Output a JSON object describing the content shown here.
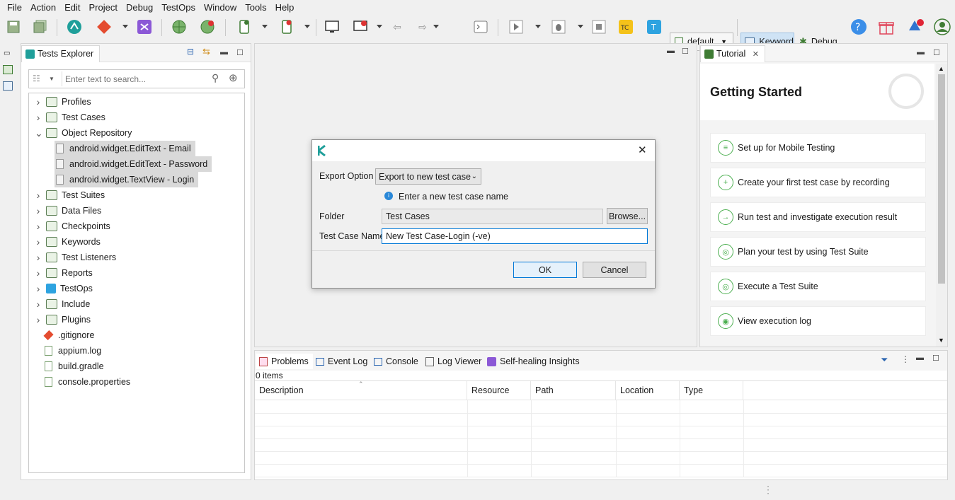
{
  "menu": [
    "File",
    "Action",
    "Edit",
    "Project",
    "Debug",
    "TestOps",
    "Window",
    "Tools",
    "Help"
  ],
  "toolbar": {
    "profile_select": "default",
    "keyword_label": "Keyword",
    "debug_label": "Debug"
  },
  "explorer": {
    "tab_title": "Tests Explorer",
    "search_placeholder": "Enter text to search...",
    "tree": [
      {
        "label": "Profiles",
        "expand": "right",
        "icon": "profiles-icon"
      },
      {
        "label": "Test Cases",
        "expand": "right",
        "icon": "test-cases-icon"
      },
      {
        "label": "Object Repository",
        "expand": "down",
        "icon": "object-repository-icon"
      },
      {
        "label": "android.widget.EditText - Email",
        "child": true,
        "selected": true,
        "icon": "test-object-icon"
      },
      {
        "label": "android.widget.EditText - Password",
        "child": true,
        "selected": true,
        "icon": "test-object-icon"
      },
      {
        "label": "android.widget.TextView - Login",
        "child": true,
        "selected": true,
        "icon": "test-object-icon"
      },
      {
        "label": "Test Suites",
        "expand": "right",
        "icon": "test-suites-icon"
      },
      {
        "label": "Data Files",
        "expand": "right",
        "icon": "data-files-icon"
      },
      {
        "label": "Checkpoints",
        "expand": "right",
        "icon": "checkpoints-icon"
      },
      {
        "label": "Keywords",
        "expand": "right",
        "icon": "keywords-icon"
      },
      {
        "label": "Test Listeners",
        "expand": "right",
        "icon": "test-listeners-icon"
      },
      {
        "label": "Reports",
        "expand": "right",
        "icon": "reports-icon"
      },
      {
        "label": "TestOps",
        "expand": "right",
        "icon": "testops-icon"
      },
      {
        "label": "Include",
        "expand": "right",
        "icon": "folder-icon"
      },
      {
        "label": "Plugins",
        "expand": "right",
        "icon": "folder-icon"
      },
      {
        "label": ".gitignore",
        "file": true,
        "icon": "git-file-icon"
      },
      {
        "label": "appium.log",
        "file": true,
        "icon": "file-icon"
      },
      {
        "label": "build.gradle",
        "file": true,
        "icon": "file-icon"
      },
      {
        "label": "console.properties",
        "file": true,
        "icon": "file-icon"
      }
    ]
  },
  "dialog": {
    "export_option_label": "Export Option",
    "export_option_value": "Export to new test case",
    "info_text": "Enter a new test case name",
    "folder_label": "Folder",
    "folder_value": "Test Cases",
    "browse_label": "Browse...",
    "name_label": "Test Case Name",
    "name_value": "New Test Case-Login (-ve)",
    "ok_label": "OK",
    "cancel_label": "Cancel"
  },
  "tutorial": {
    "tab_title": "Tutorial",
    "heading": "Getting Started",
    "items": [
      {
        "label": "Set up for Mobile Testing",
        "icon": "settings-sliders-icon"
      },
      {
        "label": "Create your first test case by recording",
        "icon": "plus-circle-icon"
      },
      {
        "label": "Run test and investigate execution result",
        "icon": "arrow-right-circle-icon"
      },
      {
        "label": "Plan your test by using Test Suite",
        "icon": "target-icon"
      },
      {
        "label": "Execute a Test Suite",
        "icon": "target-icon"
      },
      {
        "label": "View execution log",
        "icon": "eye-icon"
      }
    ]
  },
  "bottom": {
    "tabs": [
      "Problems",
      "Event Log",
      "Console",
      "Log Viewer",
      "Self-healing Insights"
    ],
    "items_count": "0 items",
    "columns": [
      "Description",
      "Resource",
      "Path",
      "Location",
      "Type"
    ]
  },
  "colors": {
    "accent": "#0078d7",
    "tutorial_green": "#4caf50",
    "katalon_purple": "#7b4fd6"
  }
}
